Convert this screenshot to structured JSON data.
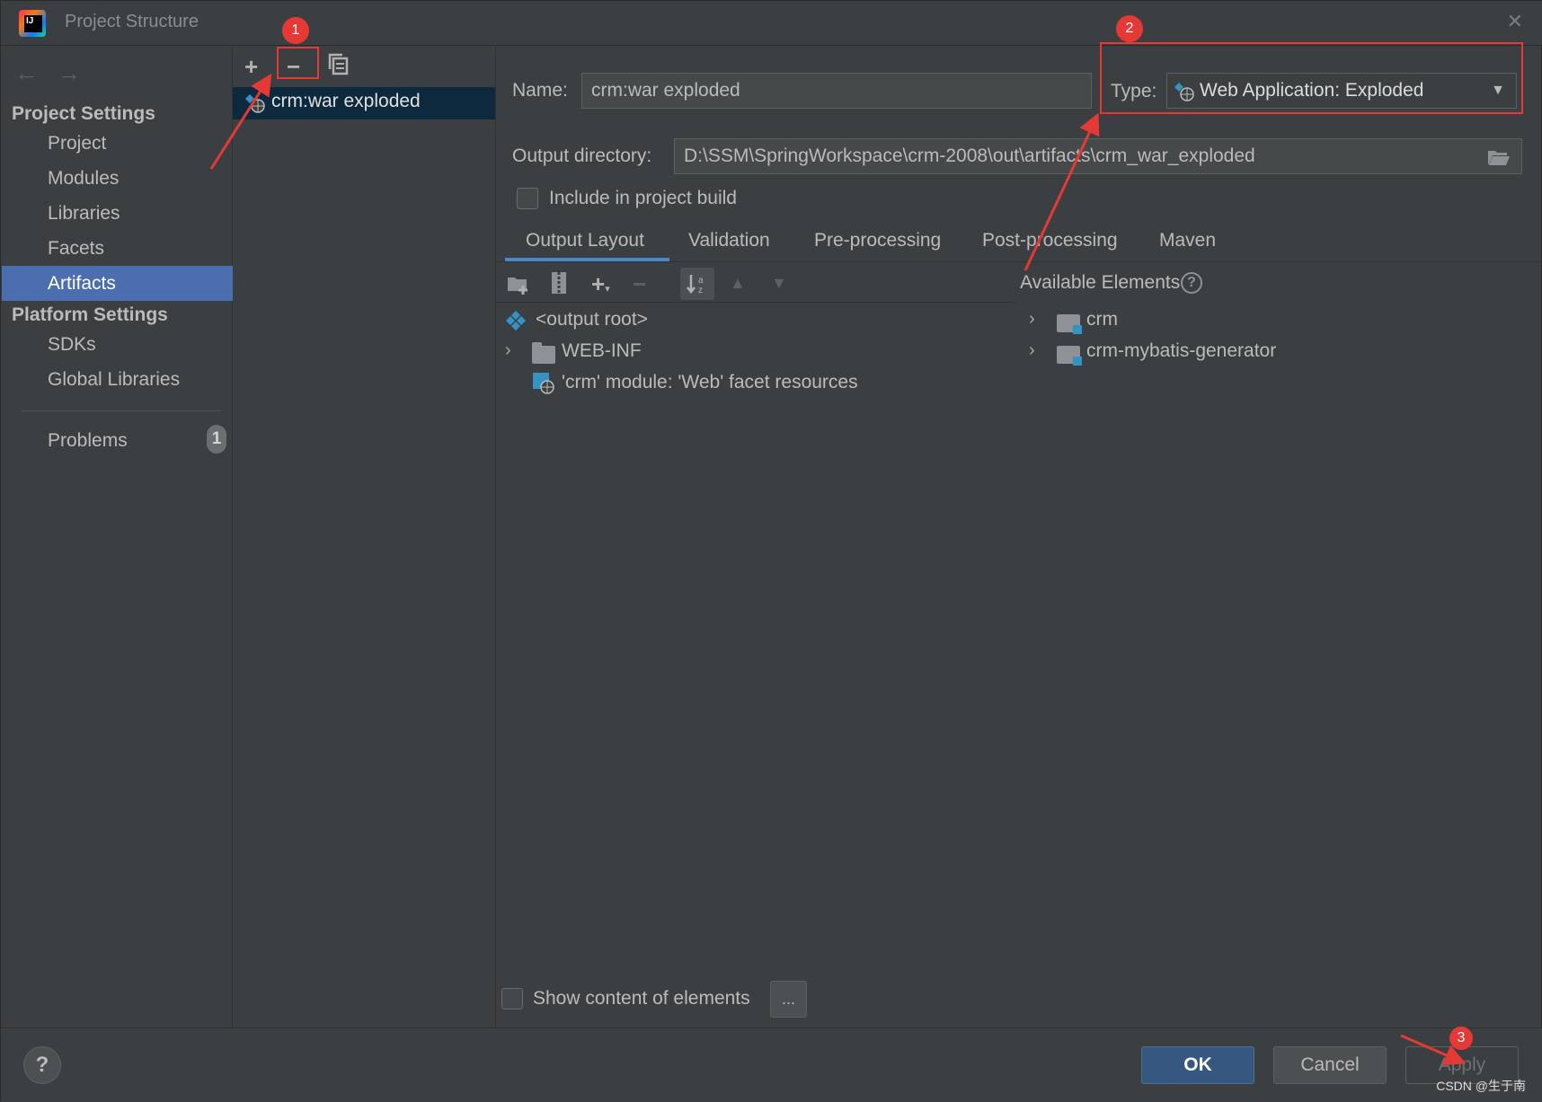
{
  "window": {
    "title": "Project Structure"
  },
  "sidebar": {
    "project_settings_label": "Project Settings",
    "project_items": [
      {
        "label": "Project"
      },
      {
        "label": "Modules"
      },
      {
        "label": "Libraries"
      },
      {
        "label": "Facets"
      },
      {
        "label": "Artifacts",
        "selected": true
      }
    ],
    "platform_settings_label": "Platform Settings",
    "platform_items": [
      {
        "label": "SDKs"
      },
      {
        "label": "Global Libraries"
      }
    ],
    "problems": {
      "label": "Problems",
      "count": "1"
    }
  },
  "artifacts": {
    "toolbar": [
      "add-icon",
      "remove-icon",
      "copy-icon"
    ],
    "items": [
      {
        "label": "crm:war exploded",
        "selected": true
      }
    ]
  },
  "form": {
    "name_label": "Name:",
    "name_value": "crm:war exploded",
    "type_label": "Type:",
    "type_value": "Web Application: Exploded",
    "output_dir_label": "Output directory:",
    "output_dir_value": "D:\\SSM\\SpringWorkspace\\crm-2008\\out\\artifacts\\crm_war_exploded",
    "include_build_label": "Include in project build",
    "include_build_checked": false
  },
  "tabs": [
    {
      "label": "Output Layout",
      "active": true
    },
    {
      "label": "Validation"
    },
    {
      "label": "Pre-processing"
    },
    {
      "label": "Post-processing"
    },
    {
      "label": "Maven"
    }
  ],
  "layout_tree": [
    {
      "label": "<output root>",
      "icon": "artifact-root-icon"
    },
    {
      "label": "WEB-INF",
      "icon": "folder-icon",
      "expandable": true
    },
    {
      "label": "'crm' module: 'Web' facet resources",
      "icon": "web-facet-icon"
    }
  ],
  "available_elements": {
    "label": "Available Elements",
    "items": [
      {
        "label": "crm",
        "icon": "module-folder-icon"
      },
      {
        "label": "crm-mybatis-generator",
        "icon": "module-folder-icon"
      }
    ]
  },
  "bottom": {
    "show_content_label": "Show content of elements",
    "show_content_checked": false,
    "ellipsis_label": "...",
    "help_label": "?",
    "ok_label": "OK",
    "cancel_label": "Cancel",
    "apply_label": "Apply"
  },
  "annotations": {
    "marker_1": "1",
    "marker_2": "2",
    "marker_3": "3",
    "color": "#e53935"
  },
  "watermark": "CSDN @生于南",
  "colors": {
    "selection": "#4b6eaf",
    "background": "#3c3f41",
    "ok_button": "#365880"
  }
}
